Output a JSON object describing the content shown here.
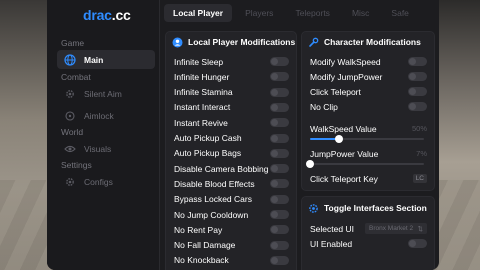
{
  "app": {
    "logo_a": "drac",
    "logo_b": ".cc"
  },
  "sidebar": {
    "sections": [
      {
        "label": "Game"
      },
      {
        "label": "Combat"
      },
      {
        "label": "World"
      },
      {
        "label": "Settings"
      }
    ],
    "items": [
      {
        "label": "Main",
        "icon": "globe-icon",
        "active": true
      },
      {
        "label": "Silent Aim",
        "icon": "gear-icon"
      },
      {
        "label": "Aimlock",
        "icon": "crosshair-icon"
      },
      {
        "label": "Visuals",
        "icon": "eye-icon"
      },
      {
        "label": "Configs",
        "icon": "gear-icon"
      }
    ]
  },
  "tabs": [
    {
      "label": "Local Player",
      "active": true
    },
    {
      "label": "Players"
    },
    {
      "label": "Teleports"
    },
    {
      "label": "Misc"
    },
    {
      "label": "Safe"
    }
  ],
  "left_panel": {
    "title": "Local Player Modifications",
    "icon": "user-icon",
    "items": [
      "Infinite Sleep",
      "Infinite Hunger",
      "Infinite Stamina",
      "Instant Interact",
      "Instant Revive",
      "Auto Pickup Cash",
      "Auto Pickup Bags",
      "Disable Camera Bobbing",
      "Disable Blood Effects",
      "Bypass Locked Cars",
      "No Jump Cooldown",
      "No Rent Pay",
      "No Fall Damage",
      "No Knockback"
    ]
  },
  "char_panel": {
    "title": "Character Modifications",
    "icon": "wrench-icon",
    "toggles": [
      "Modify WalkSpeed",
      "Modify JumpPower",
      "Click Teleport",
      "No Clip"
    ],
    "walkspeed": {
      "label": "WalkSpeed Value",
      "value": "50%",
      "fraction": 0.25
    },
    "jumppower": {
      "label": "JumpPower Value",
      "value": "7%",
      "fraction": 0.0
    },
    "teleport_key": {
      "label": "Click Teleport Key",
      "key": "LC"
    }
  },
  "iface_panel": {
    "title": "Toggle Interfaces Section",
    "icon": "gear-icon",
    "selected_label": "Selected UI",
    "selected_value": "Bronx Market 2",
    "enabled_label": "UI Enabled"
  },
  "colors": {
    "accent": "#2f8cff",
    "bg": "#1c1c1f",
    "panel": "#232327"
  }
}
